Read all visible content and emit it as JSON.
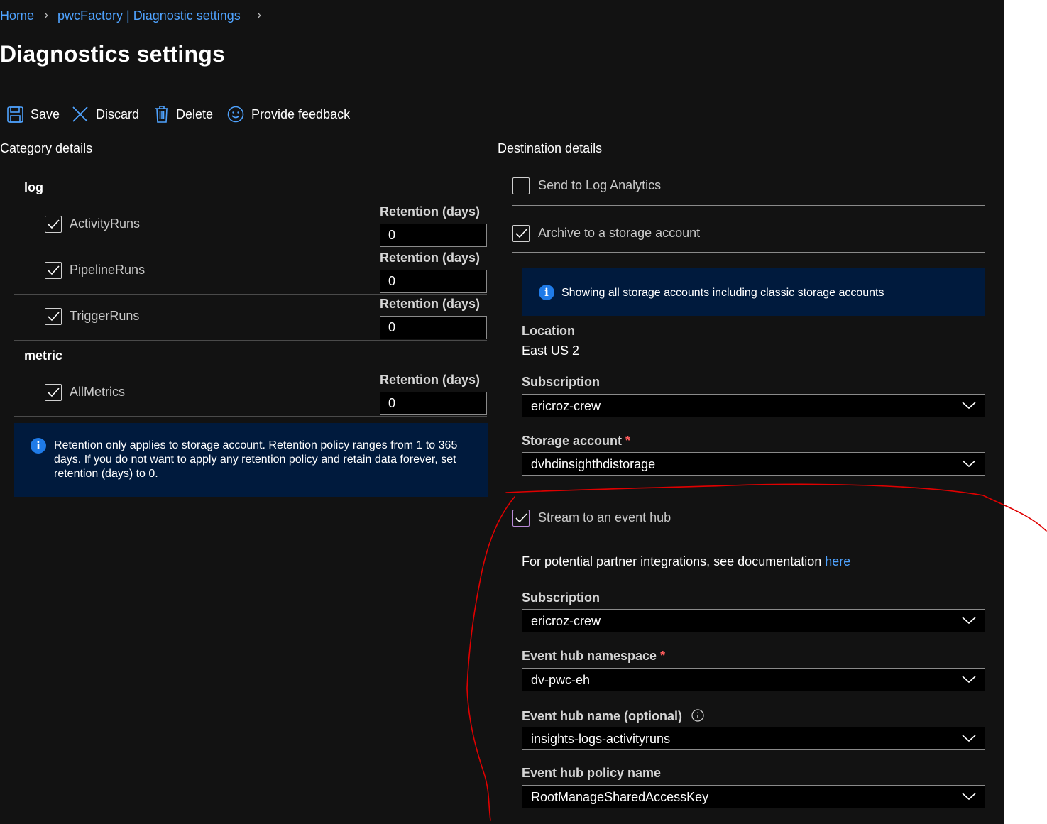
{
  "breadcrumb": {
    "home": "Home",
    "resource": "pwcFactory | Diagnostic settings"
  },
  "page_title": "Diagnostics settings",
  "toolbar": {
    "save": "Save",
    "discard": "Discard",
    "delete": "Delete",
    "feedback": "Provide feedback"
  },
  "category": {
    "heading": "Category details",
    "log_group": "log",
    "metric_group": "metric",
    "retention_label": "Retention (days)",
    "log_items": [
      {
        "label": "ActivityRuns",
        "checked": true,
        "retention": "0"
      },
      {
        "label": "PipelineRuns",
        "checked": true,
        "retention": "0"
      },
      {
        "label": "TriggerRuns",
        "checked": true,
        "retention": "0"
      }
    ],
    "metric_items": [
      {
        "label": "AllMetrics",
        "checked": true,
        "retention": "0"
      }
    ],
    "info": "Retention only applies to storage account. Retention policy ranges from 1 to 365 days. If you do not want to apply any retention policy and retain data forever, set retention (days) to 0."
  },
  "destination": {
    "heading": "Destination details",
    "log_analytics": {
      "label": "Send to Log Analytics",
      "checked": false
    },
    "storage": {
      "label": "Archive to a storage account",
      "checked": true,
      "info": "Showing all storage accounts including classic storage accounts",
      "location_label": "Location",
      "location_value": "East US 2",
      "subscription_label": "Subscription",
      "subscription_value": "ericroz-crew",
      "account_label": "Storage account",
      "account_required": "*",
      "account_value": "dvhdinsighthdistorage"
    },
    "event_hub": {
      "label": "Stream to an event hub",
      "checked": true,
      "partner_text": "For potential partner integrations, see documentation ",
      "partner_link": "here",
      "subscription_label": "Subscription",
      "subscription_value": "ericroz-crew",
      "namespace_label": "Event hub namespace",
      "namespace_required": "*",
      "namespace_value": "dv-pwc-eh",
      "name_label": "Event hub name (optional)",
      "name_value": "insights-logs-activityruns",
      "policy_label": "Event hub policy name",
      "policy_value": "RootManageSharedAccessKey"
    }
  },
  "colors": {
    "background": "#121212",
    "link": "#4fa3ff",
    "info_box": "#001a3d",
    "annotation": "#e00000",
    "required": "#ff5c5c"
  }
}
